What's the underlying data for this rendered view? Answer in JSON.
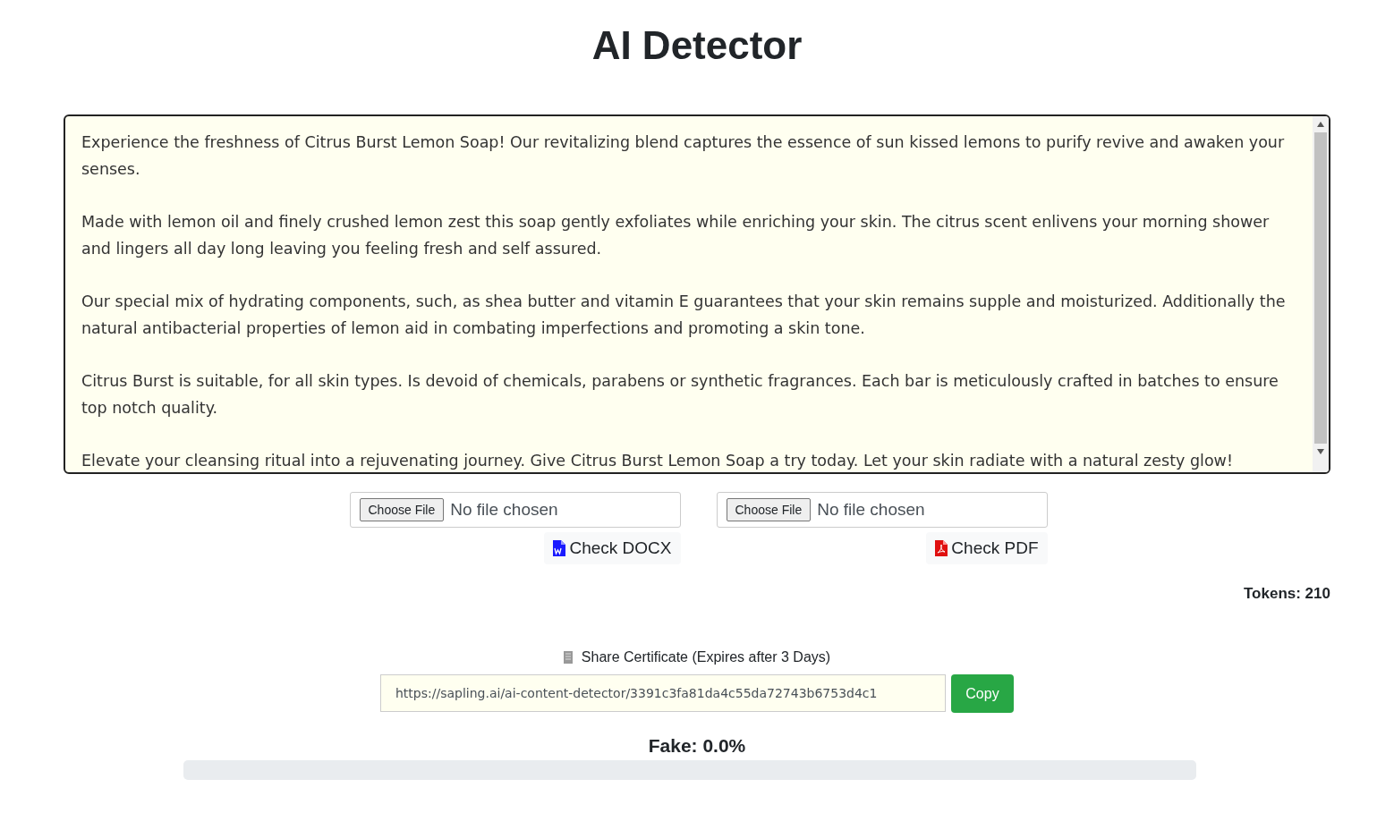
{
  "title": "AI Detector",
  "text_input": {
    "paragraphs": [
      "Experience the freshness of Citrus Burst Lemon Soap! Our revitalizing blend captures the essence of sun kissed lemons to purify revive and awaken your senses.",
      "Made with lemon oil and finely crushed lemon zest this soap gently exfoliates while enriching your skin. The citrus scent enlivens your morning shower and lingers all day long leaving you feeling fresh and self assured.",
      "Our special mix of hydrating components, such, as shea butter and vitamin E guarantees that your skin remains supple and moisturized. Additionally the natural antibacterial properties of lemon aid in combating imperfections and promoting a skin tone.",
      "Citrus Burst is suitable, for all skin types. Is devoid of chemicals, parabens or synthetic fragrances. Each bar is meticulously crafted in batches to ensure top notch quality.",
      "Elevate your cleansing ritual into a rejuvenating journey. Give Citrus Burst Lemon Soap a try today. Let your skin radiate with a natural zesty glow!"
    ]
  },
  "uploads": [
    {
      "kind": "docx",
      "choose_label": "Choose File",
      "file_status": "No file chosen",
      "check_label": "Check DOCX"
    },
    {
      "kind": "pdf",
      "choose_label": "Choose File",
      "file_status": "No file chosen",
      "check_label": "Check PDF"
    }
  ],
  "tokens": "Tokens: 210",
  "share": {
    "label": "Share Certificate (Expires after 3 Days)",
    "url": "https://sapling.ai/ai-content-detector/3391c3fa81da4c55da72743b6753d4c1",
    "copy_label": "Copy"
  },
  "result": {
    "label": "Fake: 0.0%",
    "level": 0
  }
}
